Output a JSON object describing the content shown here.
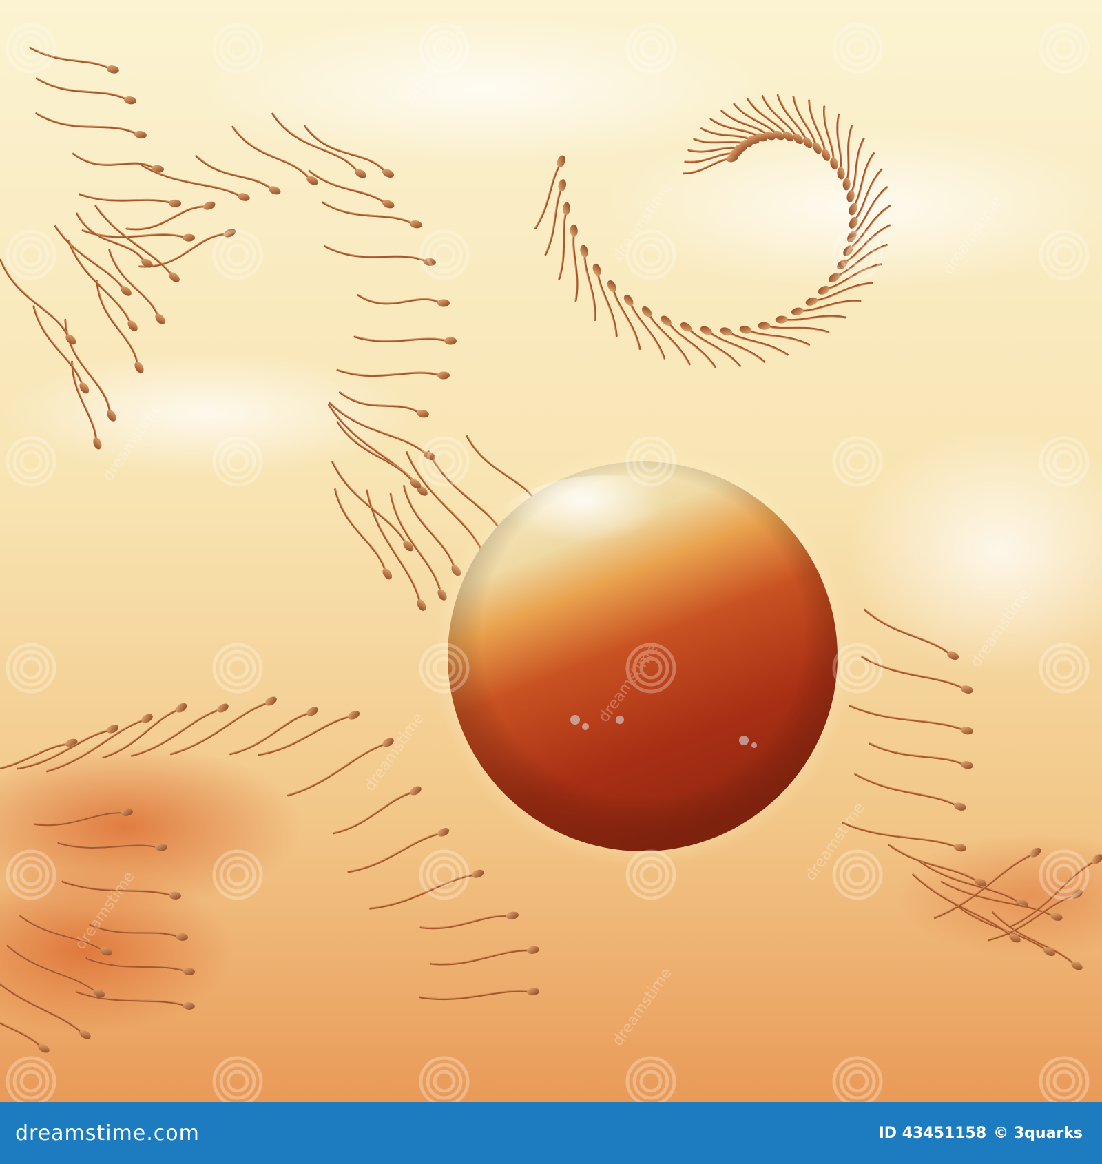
{
  "image": {
    "subject": "egg-cell-with-swarms-of-sperm",
    "colors": {
      "sky_top": "#fbf2cf",
      "sky_mid": "#f5dca7",
      "sky_bottom": "#eaa262",
      "cloud_orange": "#e07b3e",
      "sperm": "#a8562a",
      "sperm_highlight": "#e6b07a",
      "egg_light": "#f7e9bd",
      "egg_mid": "#e8883f",
      "egg_dark": "#9a2a12"
    }
  },
  "watermark": {
    "text": "dreamstime",
    "icon": "spiral-logo-icon"
  },
  "footer": {
    "logo_text": "dreamstime.com",
    "id_text": "ID 43451158",
    "credit_text": "© 3quarks",
    "background": "#1d7cc0"
  }
}
